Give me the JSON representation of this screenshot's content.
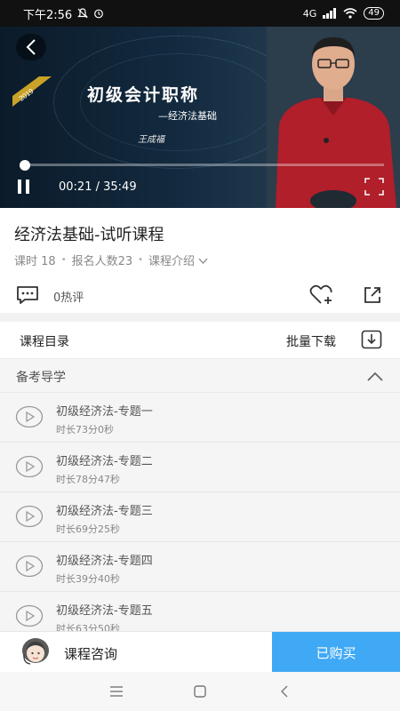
{
  "status_bar": {
    "time": "下午2:56",
    "network": "4G",
    "battery": "49"
  },
  "video": {
    "badge": "2019",
    "title": "初级会计职称",
    "subtitle": "—经济法基础",
    "signature": "王成福",
    "current_time": "00:21",
    "total_time": "35:49",
    "time_separator": " / ",
    "progress_fraction": 0.0098
  },
  "course": {
    "title": "经济法基础-试听课程",
    "lessons_label": "课时 18",
    "enrolled_label": "报名人数23",
    "intro_label": "课程介绍",
    "comment_label": "0热评"
  },
  "catalog": {
    "label": "课程目录",
    "batch_download": "批量下载",
    "section": {
      "label": "备考导学",
      "lessons": [
        {
          "name": "初级经济法-专题一",
          "duration": "时长73分0秒"
        },
        {
          "name": "初级经济法-专题二",
          "duration": "时长78分47秒"
        },
        {
          "name": "初级经济法-专题三",
          "duration": "时长69分25秒"
        },
        {
          "name": "初级经济法-专题四",
          "duration": "时长39分40秒"
        },
        {
          "name": "初级经济法-专题五",
          "duration": "时长63分50秒"
        }
      ]
    }
  },
  "bottom": {
    "consult_label": "课程咨询",
    "buy_label": "已购买"
  },
  "colors": {
    "accent": "#3fa9f5",
    "video_bg": "#132a3f",
    "presenter_shirt": "#b01f2a"
  }
}
